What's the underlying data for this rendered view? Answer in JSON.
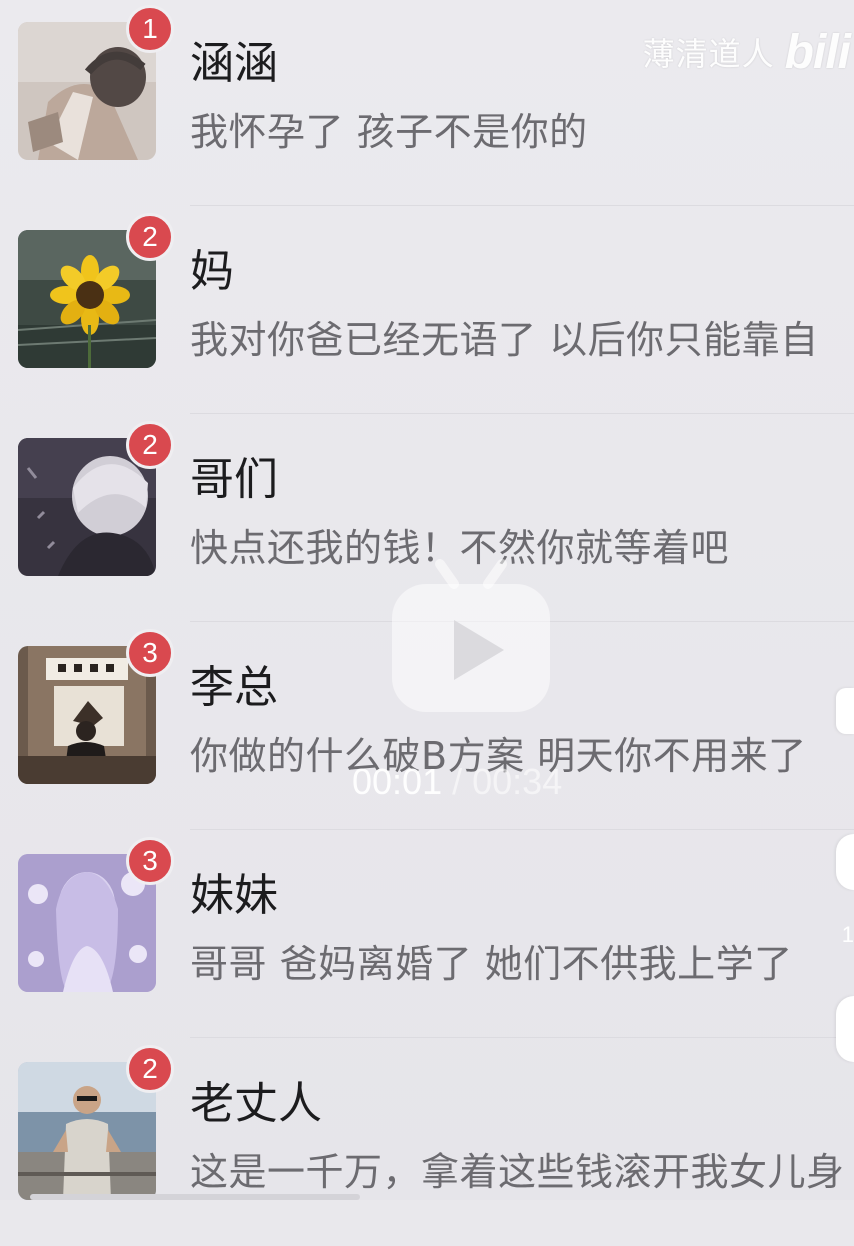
{
  "watermark": {
    "author": "薄清道人",
    "logo": "bili"
  },
  "player": {
    "current_time": "00:01",
    "separator": "/",
    "total_time": "00:34",
    "icon": "play-icon"
  },
  "chats": [
    {
      "name": "涵涵",
      "unread": "1",
      "message": "我怀孕了 孩子不是你的",
      "avatar": "person-photo-avatar"
    },
    {
      "name": "妈",
      "unread": "2",
      "message": "我对你爸已经无语了 以后你只能靠自",
      "avatar": "sunflower-avatar"
    },
    {
      "name": "哥们",
      "unread": "2",
      "message": "快点还我的钱！不然你就等着吧",
      "avatar": "anime-character-avatar"
    },
    {
      "name": "李总",
      "unread": "3",
      "message": "你做的什么破B方案 明天你不用来了",
      "avatar": "office-man-avatar"
    },
    {
      "name": "妹妹",
      "unread": "3",
      "message": "哥哥 爸妈离婚了 她们不供我上学了",
      "avatar": "anime-girl-avatar"
    },
    {
      "name": "老丈人",
      "unread": "2",
      "message": "这是一千万，拿着这些钱滚开我女儿身",
      "avatar": "old-man-sea-avatar"
    }
  ],
  "edge_label": "1",
  "colors": {
    "badge": "#d9494f",
    "name": "#1c1c1e",
    "message": "#6c6b70",
    "background": "#e9e8ec"
  }
}
